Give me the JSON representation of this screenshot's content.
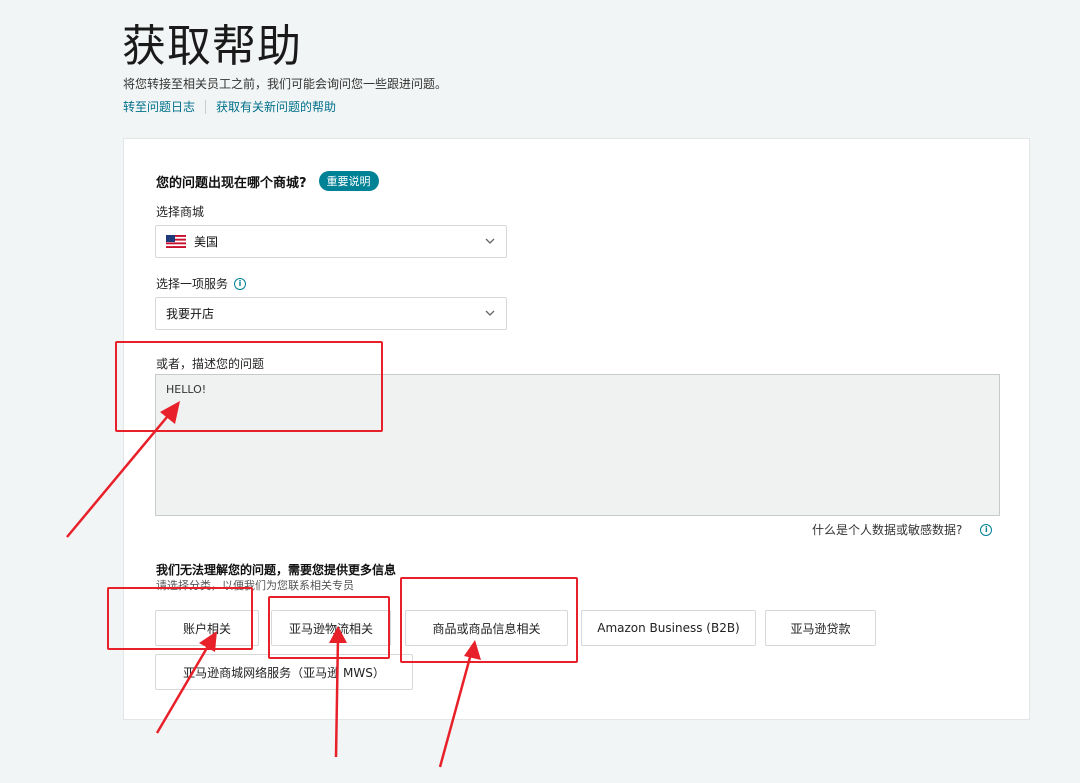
{
  "header": {
    "title": "获取帮助",
    "subtitle": "将您转接至相关员工之前，我们可能会询问您一些跟进问题。",
    "links": [
      "转至问题日志",
      "获取有关新问题的帮助"
    ]
  },
  "form": {
    "question": "您的问题出现在哪个商城?",
    "important_pill": "重要说明",
    "marketplace_label": "选择商城",
    "marketplace_value": "美国",
    "marketplace_icon": "us-flag-icon",
    "service_label": "选择一项服务",
    "service_value": "我要开店",
    "describe_label": "或者，描述您的问题",
    "describe_value": "HELLO!",
    "sensitive_link": "什么是个人数据或敏感数据?",
    "more_info_title": "我们无法理解您的问题，需要您提供更多信息",
    "more_info_hint": "请选择分类，以便我们为您联系相关专员",
    "categories": [
      "账户相关",
      "亚马逊物流相关",
      "商品或商品信息相关",
      "Amazon Business (B2B)",
      "亚马逊贷款",
      "亚马逊商城网络服务（亚马逊 MWS）"
    ]
  },
  "colors": {
    "accent": "#008296",
    "link": "#00708a",
    "annotation": "#e8202a",
    "background": "#f2f5f5"
  }
}
